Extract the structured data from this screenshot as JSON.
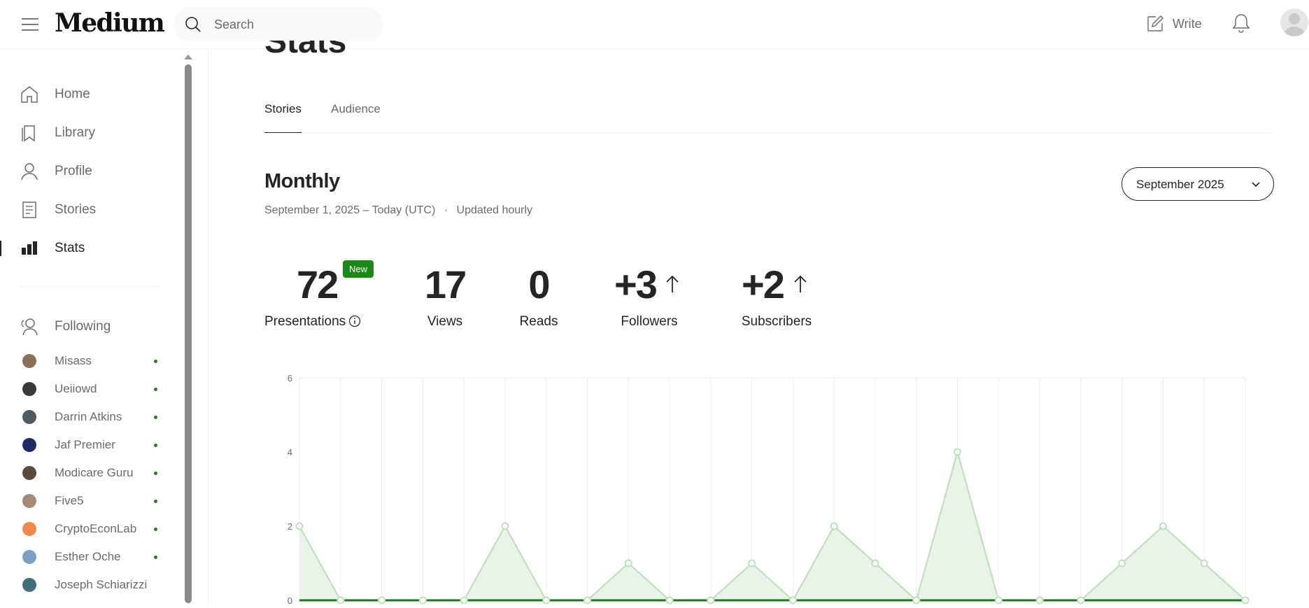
{
  "header": {
    "logo": "Medium",
    "search": {
      "placeholder": "Search"
    },
    "write_label": "Write"
  },
  "sidebar": {
    "nav": [
      {
        "label": "Home",
        "icon": "home-icon"
      },
      {
        "label": "Library",
        "icon": "bookmark-icon"
      },
      {
        "label": "Profile",
        "icon": "person-icon"
      },
      {
        "label": "Stories",
        "icon": "document-icon"
      },
      {
        "label": "Stats",
        "icon": "stats-icon",
        "active": true
      }
    ],
    "following_label": "Following",
    "following": [
      {
        "name": "Misass",
        "dot": true
      },
      {
        "name": "Ueiiowd",
        "dot": true
      },
      {
        "name": "Darrin Atkins",
        "dot": true
      },
      {
        "name": "Jaf Premier",
        "dot": true
      },
      {
        "name": "Modicare Guru",
        "dot": true
      },
      {
        "name": "Five5",
        "dot": true
      },
      {
        "name": "CryptoEconLab",
        "dot": true
      },
      {
        "name": "Esther Oche",
        "dot": true
      },
      {
        "name": "Joseph Schiarizzi",
        "dot": false
      }
    ]
  },
  "main": {
    "page_title": "Stats",
    "tabs": [
      {
        "label": "Stories",
        "active": true
      },
      {
        "label": "Audience",
        "active": false
      }
    ],
    "section_title": "Monthly",
    "date_range": "September 1, 2025 – Today (UTC)",
    "separator": "·",
    "update_note": "Updated hourly",
    "month_select": "September 2025",
    "stats": {
      "presentations": {
        "value": "72",
        "label": "Presentations",
        "badge": "New"
      },
      "views": {
        "value": "17",
        "label": "Views"
      },
      "reads": {
        "value": "0",
        "label": "Reads"
      },
      "followers": {
        "value": "+3",
        "label": "Followers"
      },
      "subscribers": {
        "value": "+2",
        "label": "Subscribers"
      }
    }
  },
  "colors": {
    "brand_green": "#1a8917",
    "chart_line": "#bfe0bd",
    "chart_fill": "#e9f3e8",
    "baseline": "#1a7a17"
  },
  "chart_data": {
    "type": "area",
    "title": "",
    "xlabel": "",
    "ylabel": "",
    "ylim": [
      0,
      6
    ],
    "yticks": [
      0,
      2,
      4,
      6
    ],
    "grid": true,
    "x": [
      1,
      2,
      3,
      4,
      5,
      6,
      7,
      8,
      9,
      10,
      11,
      12,
      13,
      14,
      15,
      16,
      17,
      18,
      19,
      20,
      21,
      22,
      23,
      24
    ],
    "series": [
      {
        "values": [
          2,
          0,
          0,
          0,
          0,
          2,
          0,
          0,
          1,
          0,
          0,
          1,
          0,
          2,
          1,
          0,
          4,
          0,
          0,
          0,
          1,
          2,
          1,
          0
        ]
      }
    ]
  }
}
